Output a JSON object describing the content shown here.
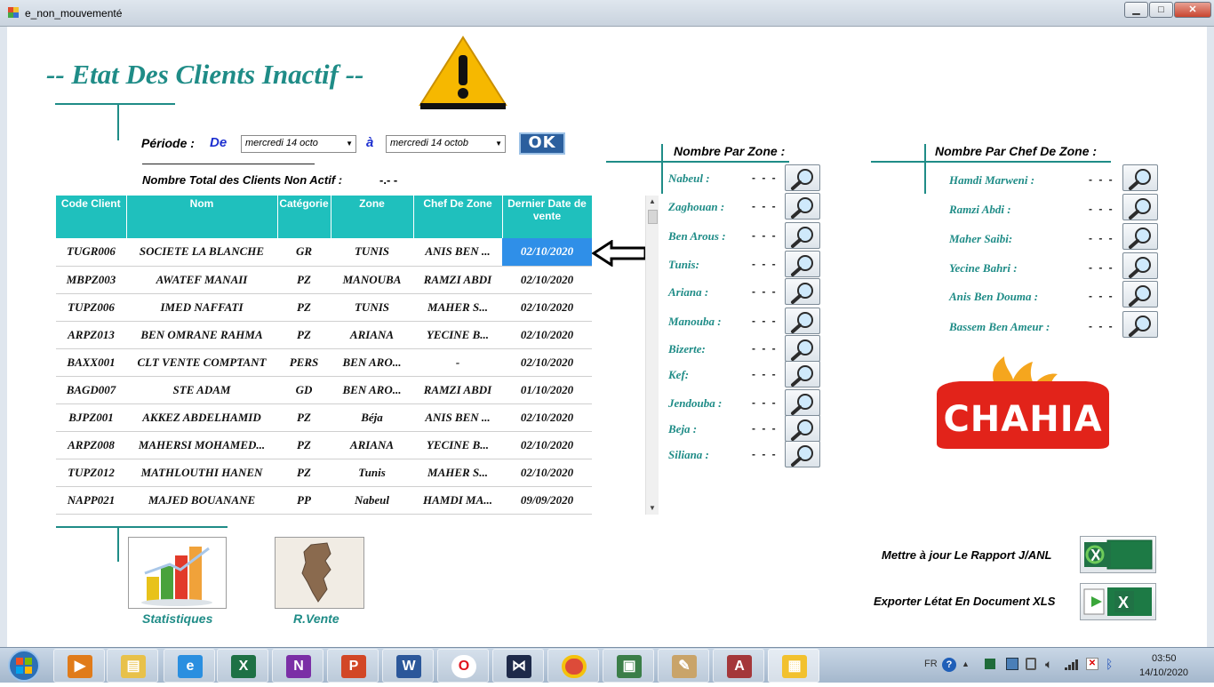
{
  "window": {
    "title": "e_non_mouvementé",
    "minimize": "▁",
    "maximize": "□",
    "close": "✕"
  },
  "header": {
    "title": "-- Etat Des Clients Inactif --"
  },
  "filter": {
    "period_label": "Période :",
    "from_label": "De",
    "from_value": "mercredi 14 octo",
    "to_label": "à",
    "to_value": "mercredi 14 octob",
    "ok_label": "OK"
  },
  "summary": {
    "total_label": "Nombre Total des Clients Non Actif :",
    "total_value": "-.- -"
  },
  "table": {
    "columns": [
      "Code Client",
      "Nom",
      "Catégorie",
      "Zone",
      "Chef De Zone",
      "Dernier Date de vente"
    ],
    "rows": [
      [
        "TUGR006",
        "SOCIETE LA BLANCHE",
        "GR",
        "TUNIS",
        "ANIS BEN ...",
        "02/10/2020"
      ],
      [
        "MBPZ003",
        "AWATEF MANAII",
        "PZ",
        "MANOUBA",
        "RAMZI ABDI",
        "02/10/2020"
      ],
      [
        "TUPZ006",
        "IMED NAFFATI",
        "PZ",
        "TUNIS",
        "MAHER S...",
        "02/10/2020"
      ],
      [
        "ARPZ013",
        "BEN OMRANE RAHMA",
        "PZ",
        "ARIANA",
        "YECINE B...",
        "02/10/2020"
      ],
      [
        "BAXX001",
        "CLT VENTE COMPTANT",
        "PERS",
        "BEN ARO...",
        "-",
        "02/10/2020"
      ],
      [
        "BAGD007",
        "STE ADAM",
        "GD",
        "BEN ARO...",
        "RAMZI ABDI",
        "01/10/2020"
      ],
      [
        "BJPZ001",
        "AKKEZ ABDELHAMID",
        "PZ",
        "Béja",
        "ANIS BEN ...",
        "02/10/2020"
      ],
      [
        "ARPZ008",
        "MAHERSI MOHAMED...",
        "PZ",
        "ARIANA",
        "YECINE B...",
        "02/10/2020"
      ],
      [
        "TUPZ012",
        "MATHLOUTHI  HANEN",
        "PZ",
        "Tunis",
        "MAHER S...",
        "02/10/2020"
      ],
      [
        "NAPP021",
        "MAJED BOUANANE",
        "PP",
        "Nabeul",
        "HAMDI MA...",
        "09/09/2020"
      ]
    ]
  },
  "zones": {
    "title": "Nombre Par Zone :",
    "items": [
      {
        "name": "Nabeul :",
        "value": "- - -"
      },
      {
        "name": "Zaghouan :",
        "value": "- - -"
      },
      {
        "name": "Ben Arous :",
        "value": "- - -"
      },
      {
        "name": "Tunis:",
        "value": "- - -"
      },
      {
        "name": "Ariana :",
        "value": "- - -"
      },
      {
        "name": "Manouba :",
        "value": "- - -"
      },
      {
        "name": "Bizerte:",
        "value": "- - -"
      },
      {
        "name": "Kef:",
        "value": "- - -"
      },
      {
        "name": "Jendouba :",
        "value": "- - -"
      },
      {
        "name": "Beja :",
        "value": "- - -"
      },
      {
        "name": "Siliana :",
        "value": "- - -"
      }
    ]
  },
  "chefs": {
    "title": "Nombre Par Chef De Zone :",
    "items": [
      {
        "name": "Hamdi Marweni :",
        "value": "- - -"
      },
      {
        "name": "Ramzi Abdi :",
        "value": "- - -"
      },
      {
        "name": "Maher Saibi:",
        "value": "- - -"
      },
      {
        "name": "Yecine Bahri :",
        "value": "- - -"
      },
      {
        "name": "Anis Ben Douma :",
        "value": "- - -"
      },
      {
        "name": "Bassem Ben Ameur :",
        "value": "- - -"
      }
    ]
  },
  "logo": {
    "text": "CHAHIA"
  },
  "bottom": {
    "stats_label": "Statistiques",
    "sales_label": "R.Vente",
    "update_label": "Mettre à jour Le Rapport J/ANL",
    "export_label": "Exporter Létat En Document XLS"
  },
  "taskbar": {
    "lang": "FR",
    "time": "03:50",
    "date": "14/10/2020"
  },
  "colors": {
    "accent": "#1f8c87",
    "header": "#1fc0bd",
    "selected": "#2f8fe8"
  }
}
